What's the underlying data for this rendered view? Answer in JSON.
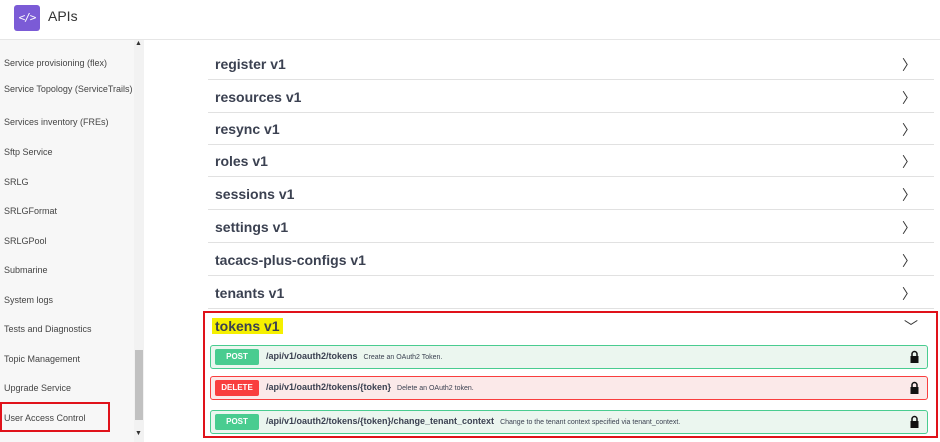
{
  "header": {
    "title": "APIs",
    "logo_glyph": "</>"
  },
  "sidebar": {
    "items": [
      {
        "label": "Service provisioning (flex)"
      },
      {
        "label": "Service Topology (ServiceTrails)"
      },
      {
        "label": "Services inventory (FREs)"
      },
      {
        "label": "Sftp Service"
      },
      {
        "label": "SRLG"
      },
      {
        "label": "SRLGFormat"
      },
      {
        "label": "SRLGPool"
      },
      {
        "label": "Submarine"
      },
      {
        "label": "System logs"
      },
      {
        "label": "Tests and Diagnostics"
      },
      {
        "label": "Topic Management"
      },
      {
        "label": "Upgrade Service"
      },
      {
        "label": "User Access Control"
      }
    ]
  },
  "apis": [
    {
      "name": "register v1"
    },
    {
      "name": "resources v1"
    },
    {
      "name": "resync v1"
    },
    {
      "name": "roles v1"
    },
    {
      "name": "sessions v1"
    },
    {
      "name": "settings v1"
    },
    {
      "name": "tacacs-plus-configs v1"
    },
    {
      "name": "tenants v1"
    }
  ],
  "tokens": {
    "title": "tokens v1",
    "operations": [
      {
        "method": "POST",
        "path": "/api/v1/oauth2/tokens",
        "desc": "Create an OAuth2 Token."
      },
      {
        "method": "DELETE",
        "path": "/api/v1/oauth2/tokens/{token}",
        "desc": "Delete an OAuth2 token."
      },
      {
        "method": "POST",
        "path": "/api/v1/oauth2/tokens/{token}/change_tenant_context",
        "desc": "Change to the tenant context specified via tenant_context."
      }
    ]
  },
  "colors": {
    "accent": "#7b5bd6",
    "highlight": "#f5f000",
    "post": "#49cc90",
    "delete": "#f93e3e",
    "callout": "#e0121a"
  },
  "icons": {
    "expand": "chevron-right-icon",
    "collapse": "chevron-down-icon",
    "lock": "lock-icon"
  }
}
